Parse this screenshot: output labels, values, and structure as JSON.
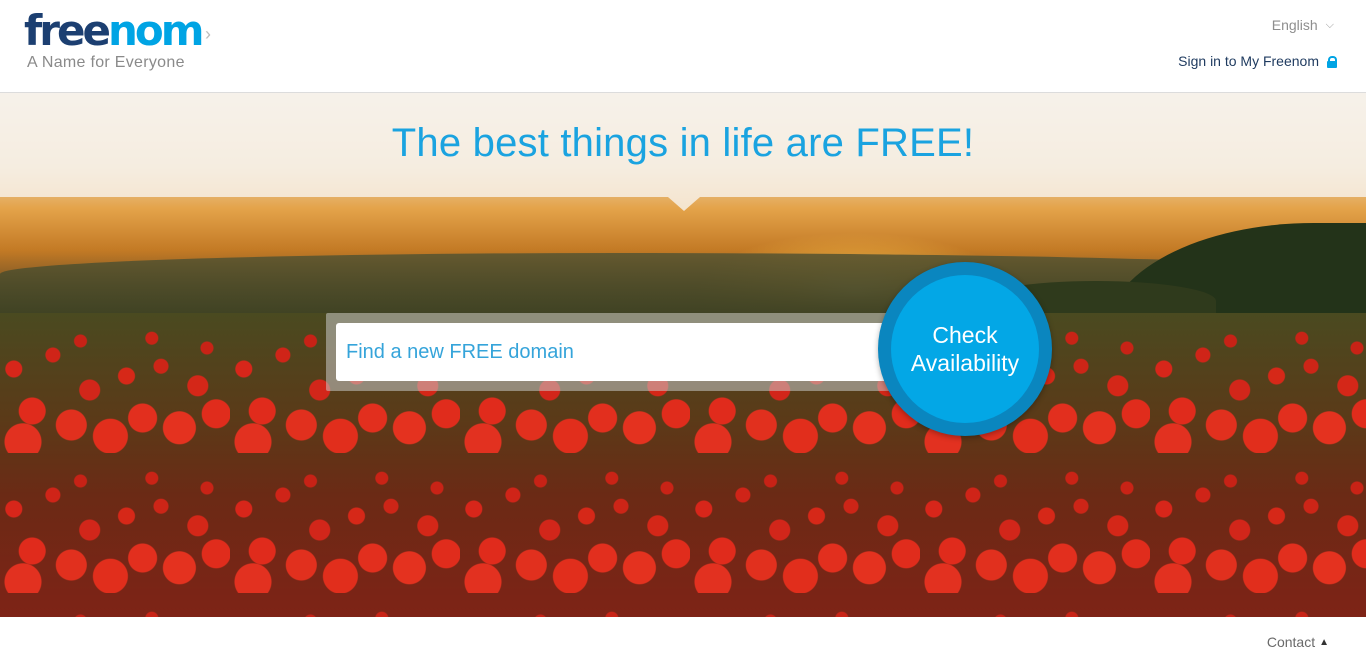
{
  "header": {
    "logo": {
      "part1": "free",
      "part2": "nom",
      "tagline": "A Name for Everyone"
    },
    "language": {
      "label": "English"
    },
    "signin": {
      "label": "Sign in to My Freenom"
    }
  },
  "hero": {
    "title": "The best things in life are FREE!",
    "search": {
      "placeholder": "Find a new FREE domain",
      "value": ""
    },
    "check_button": {
      "line1": "Check",
      "line2": "Availability"
    }
  },
  "footer": {
    "contact_label": "Contact"
  },
  "colors": {
    "brand_dark": "#1c3f71",
    "brand_blue": "#00a4e4",
    "button_ring": "#0a86bf"
  },
  "icons": {
    "lock": "lock-icon",
    "chevron_down": "chevron-down-icon",
    "chevron_up": "chevron-up-icon",
    "chevron_right": "chevron-right-icon"
  }
}
